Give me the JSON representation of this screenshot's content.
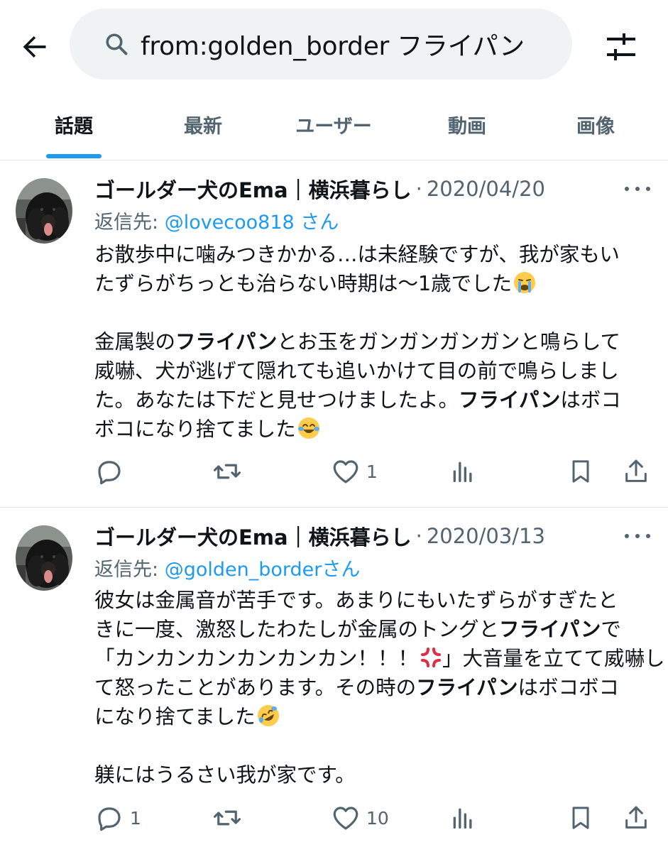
{
  "header": {
    "search_query": "from:golden_border フライパン"
  },
  "tabs": [
    {
      "label": "話題",
      "active": true
    },
    {
      "label": "最新",
      "active": false
    },
    {
      "label": "ユーザー",
      "active": false
    },
    {
      "label": "動画",
      "active": false
    },
    {
      "label": "画像",
      "active": false
    }
  ],
  "colors": {
    "accent": "#1d9bf0",
    "secondary_text": "#536471",
    "search_bg": "#eff3f4"
  },
  "tweets": [
    {
      "author": "ゴールダー犬のEma｜横浜暮らし",
      "separator": "·",
      "date": "2020/04/20",
      "reply_prefix": "返信先: ",
      "reply_handle": "@lovecoo818 さん",
      "body_lines": [
        [
          "お散歩中に噛みつきかかる…は未経験ですが、我が家もい"
        ],
        [
          "たずらがちっとも治らない時期は〜1歳でした"
        ],
        [],
        [
          "金属製の",
          "フライパン",
          "とお玉をガンガンガンガンと鳴らして"
        ],
        [
          "威嚇、犬が逃げて隠れても追いかけて目の前で鳴らしまし"
        ],
        [
          "た。あなたは下だと見せつけましたよ。",
          "フライパン",
          "はボコ"
        ],
        [
          "ボコになり捨てました"
        ]
      ],
      "emojis": [
        "loudly-crying-face",
        "face-with-tears-of-joy"
      ],
      "counts": {
        "reply": "",
        "retweet": "",
        "like": "1"
      }
    },
    {
      "author": "ゴールダー犬のEma｜横浜暮らし",
      "separator": "·",
      "date": "2020/03/13",
      "reply_prefix": "返信先: ",
      "reply_handle": "@golden_borderさん",
      "body_lines": [
        [
          "彼女は金属音が苦手です。あまりにもいたずらがすぎたと"
        ],
        [
          "きに一度、激怒したわたしが金属のトングと",
          "フライパン",
          "で"
        ],
        [
          "「カンカンカンカンカンカン！！！",
          "」大音量を立てて威嚇し"
        ],
        [
          "て怒ったことがあります。その時の",
          "フライパン",
          "はボコボコ"
        ],
        [
          "になり捨てました"
        ],
        [],
        [
          "躾にはうるさい我が家です。"
        ]
      ],
      "emojis": [
        "anger-symbol",
        "rolling-on-floor-laughing"
      ],
      "counts": {
        "reply": "1",
        "retweet": "",
        "like": "10"
      }
    }
  ]
}
